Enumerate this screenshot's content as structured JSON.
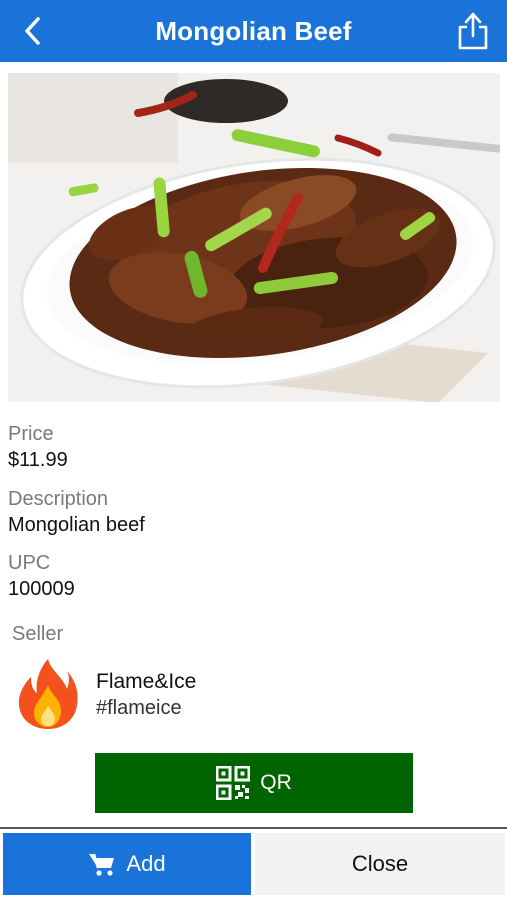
{
  "header": {
    "title": "Mongolian Beef",
    "back_icon": "chevron-left-icon",
    "share_icon": "share-icon",
    "bar_color": "#1a73d9"
  },
  "product": {
    "image_alt": "Mongolian Beef",
    "price_label": "Price",
    "price": "$11.99",
    "description_label": "Description",
    "description": "Mongolian beef",
    "upc_label": "UPC",
    "upc": "100009"
  },
  "seller": {
    "label": "Seller",
    "name": "Flame&Ice",
    "handle": "#flameice",
    "avatar_icon": "flame-icon"
  },
  "actions": {
    "qr_label": "QR",
    "qr_icon": "qr-code-icon",
    "qr_color": "#006400",
    "add_label": "Add",
    "add_icon": "cart-icon",
    "add_color": "#1a73d9",
    "close_label": "Close"
  }
}
